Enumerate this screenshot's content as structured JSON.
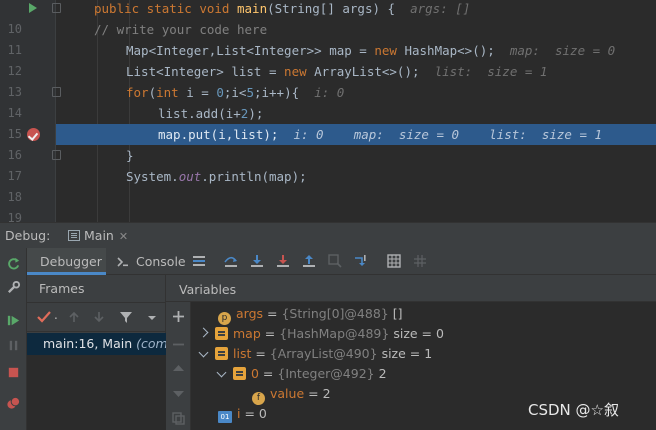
{
  "editor": {
    "lines": [
      {
        "num": "10",
        "kw1": "public static void ",
        "fn": "main",
        "rest": "(String[] args) {",
        "hint": "args: []"
      },
      {
        "num": "11",
        "comment": "// write your code here"
      },
      {
        "num": "12",
        "a": "Map<Integer,List<Integer>> map = ",
        "kw": "new",
        "b": " HashMap<>();",
        "hint": "map:  size = 0"
      },
      {
        "num": "13",
        "a": "List<Integer> list = ",
        "kw": "new",
        "b": " ArrayList<>();",
        "hint": "list:  size = 1"
      },
      {
        "num": "14",
        "kw1": "for",
        "a": "(",
        "kw2": "int",
        "b": " i = ",
        "n0": "0",
        "c": ";i<",
        "n5": "5",
        "d": ";i++){",
        "hint": "i: 0"
      },
      {
        "num": "15",
        "a": "list.add(i+",
        "n2": "2",
        "b": ");"
      },
      {
        "num": "16",
        "a": "map.put(i,list);",
        "hint": "i: 0    map:  size = 0    list:  size = 1"
      },
      {
        "num": "17",
        "a": "}"
      },
      {
        "num": "18",
        "a": "System.",
        "out": "out",
        "b": ".println(map);"
      },
      {
        "num": "19",
        "a": ""
      }
    ]
  },
  "debug": {
    "label": "Debug:",
    "config_tab": "Main",
    "tabs": {
      "debugger": "Debugger",
      "console": "Console"
    },
    "frames_header": "Frames",
    "frame": {
      "text": "main:16, Main ",
      "pkg": "(com.e"
    },
    "variables_header": "Variables",
    "vars": [
      {
        "badge": "p",
        "name": "args",
        "ref": "{String[0]@488}",
        "val": "[]"
      },
      {
        "badge": "eq",
        "name": "map",
        "ref": "{HashMap@489}",
        "val": "size = 0"
      },
      {
        "badge": "eq",
        "name": "list",
        "ref": "{ArrayList@490}",
        "val": "size = 1"
      },
      {
        "badge": "eq",
        "name": "0",
        "ref": "{Integer@492}",
        "val": "2"
      },
      {
        "badge": "f",
        "name": "value",
        "ref": "",
        "val": "2"
      },
      {
        "badge": "01",
        "name": "i",
        "ref": "",
        "val": "0"
      }
    ]
  },
  "watermark": "CSDN @☆叙",
  "colors": {
    "accent": "#4a88c7",
    "highlight_line": "#2d5a8c",
    "keyword": "#cc7832"
  }
}
